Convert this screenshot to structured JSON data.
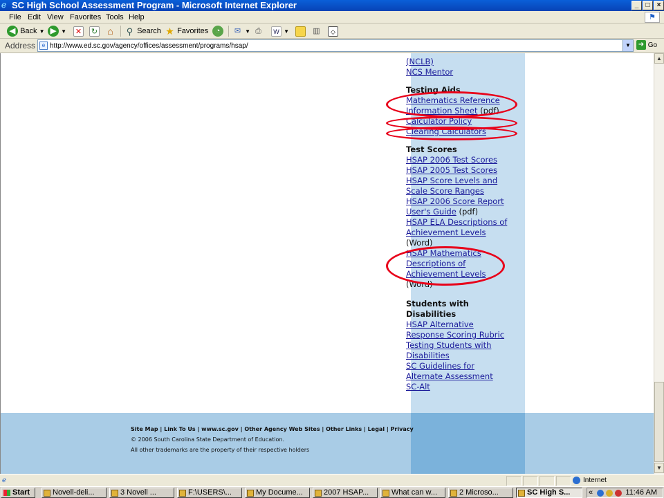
{
  "window": {
    "title": "SC High School Assessment Program - Microsoft Internet Explorer"
  },
  "menu": [
    "File",
    "Edit",
    "View",
    "Favorites",
    "Tools",
    "Help"
  ],
  "toolbar": {
    "back_label": "Back",
    "search_label": "Search",
    "favorites_label": "Favorites"
  },
  "address": {
    "label": "Address",
    "url": "http://www.ed.sc.gov/agency/offices/assessment/programs/hsap/",
    "go_label": "Go"
  },
  "sidebar": {
    "top_links": [
      "(NCLB)",
      "NCS Mentor"
    ],
    "testing_aids": {
      "heading": "Testing Aids",
      "link1_a": "Mathematics Reference",
      "link1_b": "Information Sheet",
      "link1_suffix": " (pdf)",
      "link2": "Calculator Policy",
      "link3": "Clearing Calculators"
    },
    "test_scores": {
      "heading": "Test Scores",
      "l1": "HSAP 2006 Test Scores",
      "l2": "HSAP 2005 Test Scores",
      "l3a": "HSAP Score Levels and",
      "l3b": "Scale Score Ranges",
      "l4a": "HSAP 2006 Score Report",
      "l4b": "User's Guide",
      "l4_suffix": " (pdf)",
      "l5a": "HSAP ELA Descriptions of",
      "l5b": "Achievement Levels",
      "l5_suffix": "(Word)",
      "l6a": "HSAP Mathematics",
      "l6b": "Descriptions of",
      "l6c": "Achievement Levels",
      "l6_suffix": "(Word)"
    },
    "disabilities": {
      "heading_a": "Students with",
      "heading_b": "Disabilities",
      "l1a": "HSAP Alternative",
      "l1b": "Response Scoring Rubric",
      "l2a": "Testing Students with",
      "l2b": "Disabilities",
      "l3a": "SC Guidelines for",
      "l3b": "Alternate Assessment",
      "l4": "SC-Alt"
    }
  },
  "footer": {
    "links": "Site Map | Link To Us | www.sc.gov | Other Agency Web Sites | Other Links | Legal | Privacy",
    "copyright": "© 2006 South Carolina State Department of Education.",
    "trademarks": "All other trademarks are the property of their respective holders"
  },
  "status": {
    "zone": "Internet"
  },
  "taskbar": {
    "start": "Start",
    "tasks": [
      "Novell-deli...",
      "3 Novell ...",
      "F:\\USERS\\...",
      "My Docume...",
      "2007 HSAP...",
      "What can w...",
      "2 Microso...",
      "SC High S..."
    ],
    "clock": "11:46 AM"
  },
  "colors": {
    "annotation": "#e8001a",
    "sidebar_bg": "#c6def0",
    "footer_bg": "#a9cce6"
  }
}
